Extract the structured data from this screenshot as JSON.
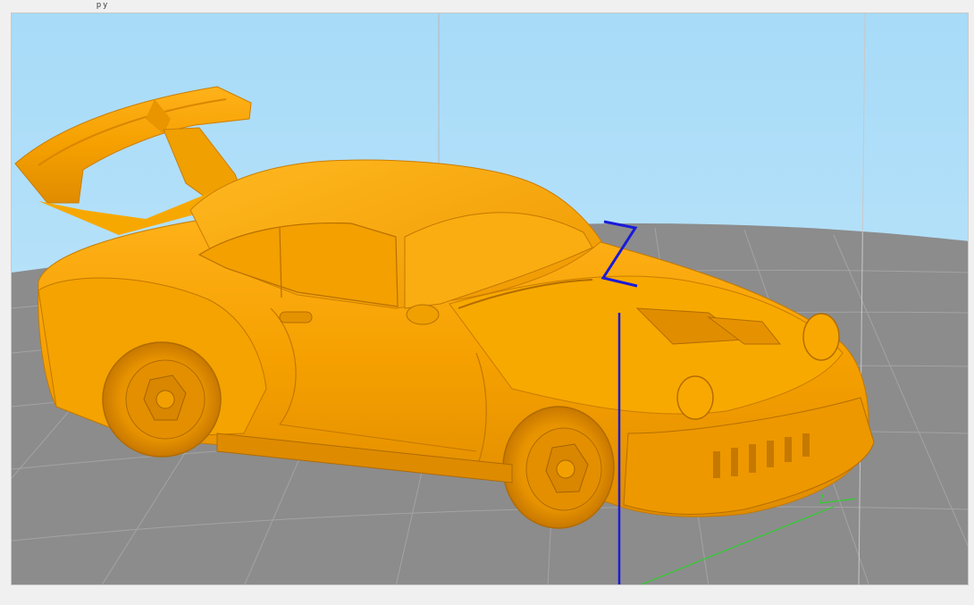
{
  "window": {
    "partial_title": "p          y"
  },
  "viewport": {
    "model": "porsche-widebody-car",
    "model_color": "#f5a000",
    "background_color": "#a8dcfa",
    "build_plate_color": "#8c8c8c",
    "axis_colors": {
      "x": "#2fcf2f",
      "y": "#2fcf2f",
      "z": "#1a1ad8"
    },
    "z_axis_label": "Z"
  }
}
